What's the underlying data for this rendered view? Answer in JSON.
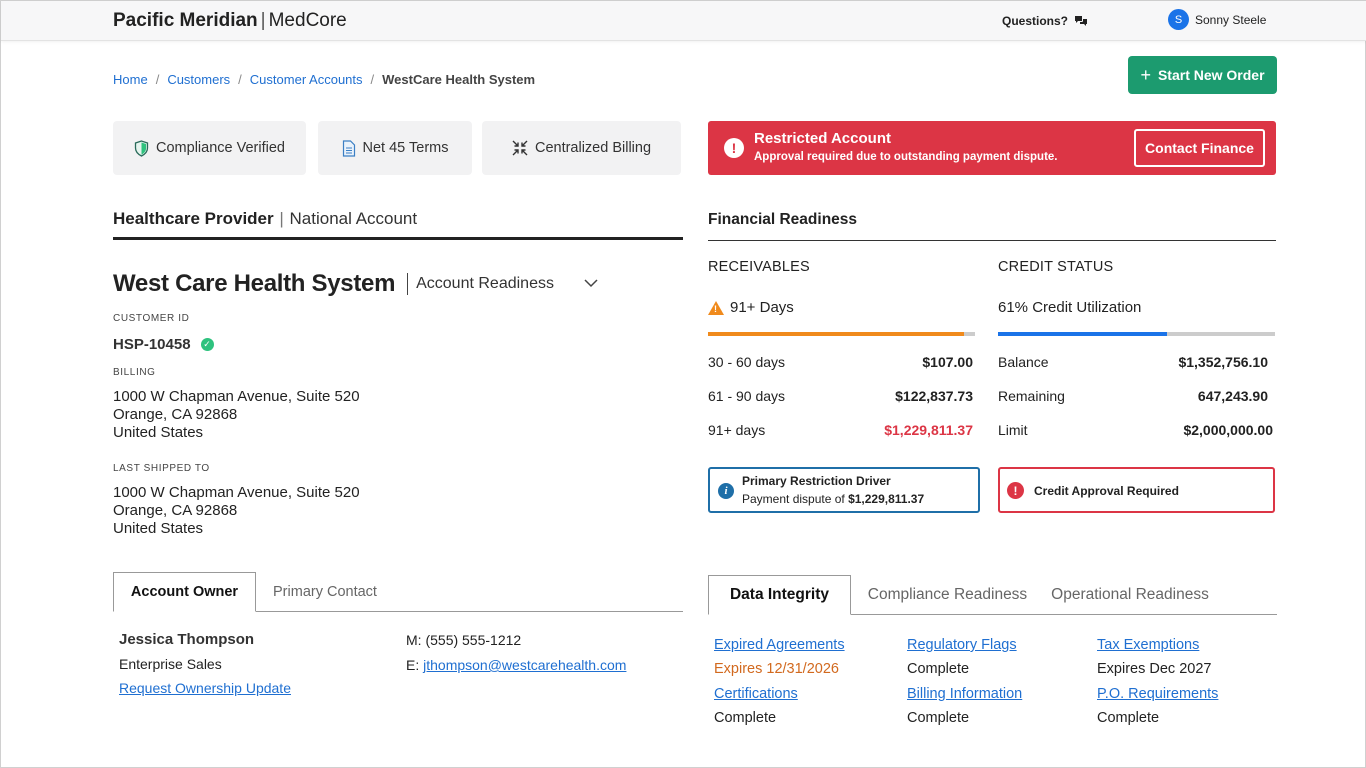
{
  "header": {
    "brand_primary": "Pacific Meridian",
    "brand_secondary": "MedCore",
    "questions_label": "Questions?",
    "user_initial": "S",
    "user_name": "Sonny Steele"
  },
  "breadcrumb": {
    "items": [
      "Home",
      "Customers",
      "Customer Accounts"
    ],
    "current": "WestCare Health System"
  },
  "actions": {
    "start_order_label": "Start New Order"
  },
  "badges": {
    "compliance": "Compliance Verified",
    "terms": "Net 45 Terms",
    "billing": "Centralized Billing"
  },
  "restriction": {
    "title": "Restricted Account",
    "message": "Approval required due to outstanding payment dispute.",
    "button_label": "Contact Finance",
    "color": "#dc3545"
  },
  "account": {
    "section_type": "Healthcare Provider",
    "section_subtype": "National Account",
    "name": "West Care Health System",
    "view_selector": "Account Readiness",
    "customer_id_label": "CUSTOMER ID",
    "customer_id": "HSP-10458",
    "billing_label": "BILLING",
    "billing_address": [
      "1000 W Chapman Avenue, Suite 520",
      "Orange, CA 92868",
      "United States"
    ],
    "shipped_label": "LAST SHIPPED TO",
    "shipped_address": [
      "1000 W Chapman Avenue, Suite 520",
      "Orange, CA 92868",
      "United States"
    ]
  },
  "owner_tabs": {
    "tabs": [
      "Account Owner",
      "Primary Contact"
    ],
    "active": "Account Owner",
    "owner_name": "Jessica Thompson",
    "owner_role": "Enterprise Sales",
    "request_link": "Request Ownership Update",
    "phone_label": "M:",
    "phone": "(555) 555-1212",
    "email_label": "E:",
    "email": "jthompson@westcarehealth.com"
  },
  "financial": {
    "title": "Financial Readiness",
    "receivables": {
      "title": "RECEIVABLES",
      "status": "91+ Days",
      "progress": 0.96,
      "progress_color": "#f08a1c",
      "rows": [
        {
          "label": "30 - 60 days",
          "value": "$107.00"
        },
        {
          "label": "61 - 90 days",
          "value": "$122,837.73"
        },
        {
          "label": "91+ days",
          "value": "$1,229,811.37"
        }
      ]
    },
    "credit": {
      "title": "CREDIT STATUS",
      "status": "61% Credit Utilization",
      "progress": 0.61,
      "progress_color": "#1a73e8",
      "rows": [
        {
          "label": "Balance",
          "value": "$1,352,756.10"
        },
        {
          "label": "Remaining",
          "value": "647,243.90"
        },
        {
          "label": "Limit",
          "value": "$2,000,000.00"
        }
      ]
    },
    "driver": {
      "title": "Primary Restriction Driver",
      "text": "Payment dispute of",
      "amount": "$1,229,811.37"
    },
    "credit_alert": "Credit Approval Required"
  },
  "readiness_tabs": {
    "tabs": [
      "Data Integrity",
      "Compliance Readiness",
      "Operational Readiness"
    ],
    "active": "Data Integrity",
    "items": [
      {
        "link": "Expired Agreements",
        "value": "Expires 12/31/2026"
      },
      {
        "link": "Regulatory Flags",
        "value": "Complete"
      },
      {
        "link": "Tax Exemptions",
        "value": "Expires Dec 2027"
      },
      {
        "link": "Certifications",
        "value": "Complete"
      },
      {
        "link": "Billing Information",
        "value": "Complete"
      },
      {
        "link": "P.O. Requirements",
        "value": "Complete"
      }
    ]
  },
  "icons": {
    "compliance": "shield-icon",
    "terms": "document-icon",
    "billing": "merge-arrows-icon",
    "questions": "chat-bubbles-icon",
    "restriction": "exclamation-icon",
    "info": "info-icon",
    "warning": "warning-icon"
  }
}
